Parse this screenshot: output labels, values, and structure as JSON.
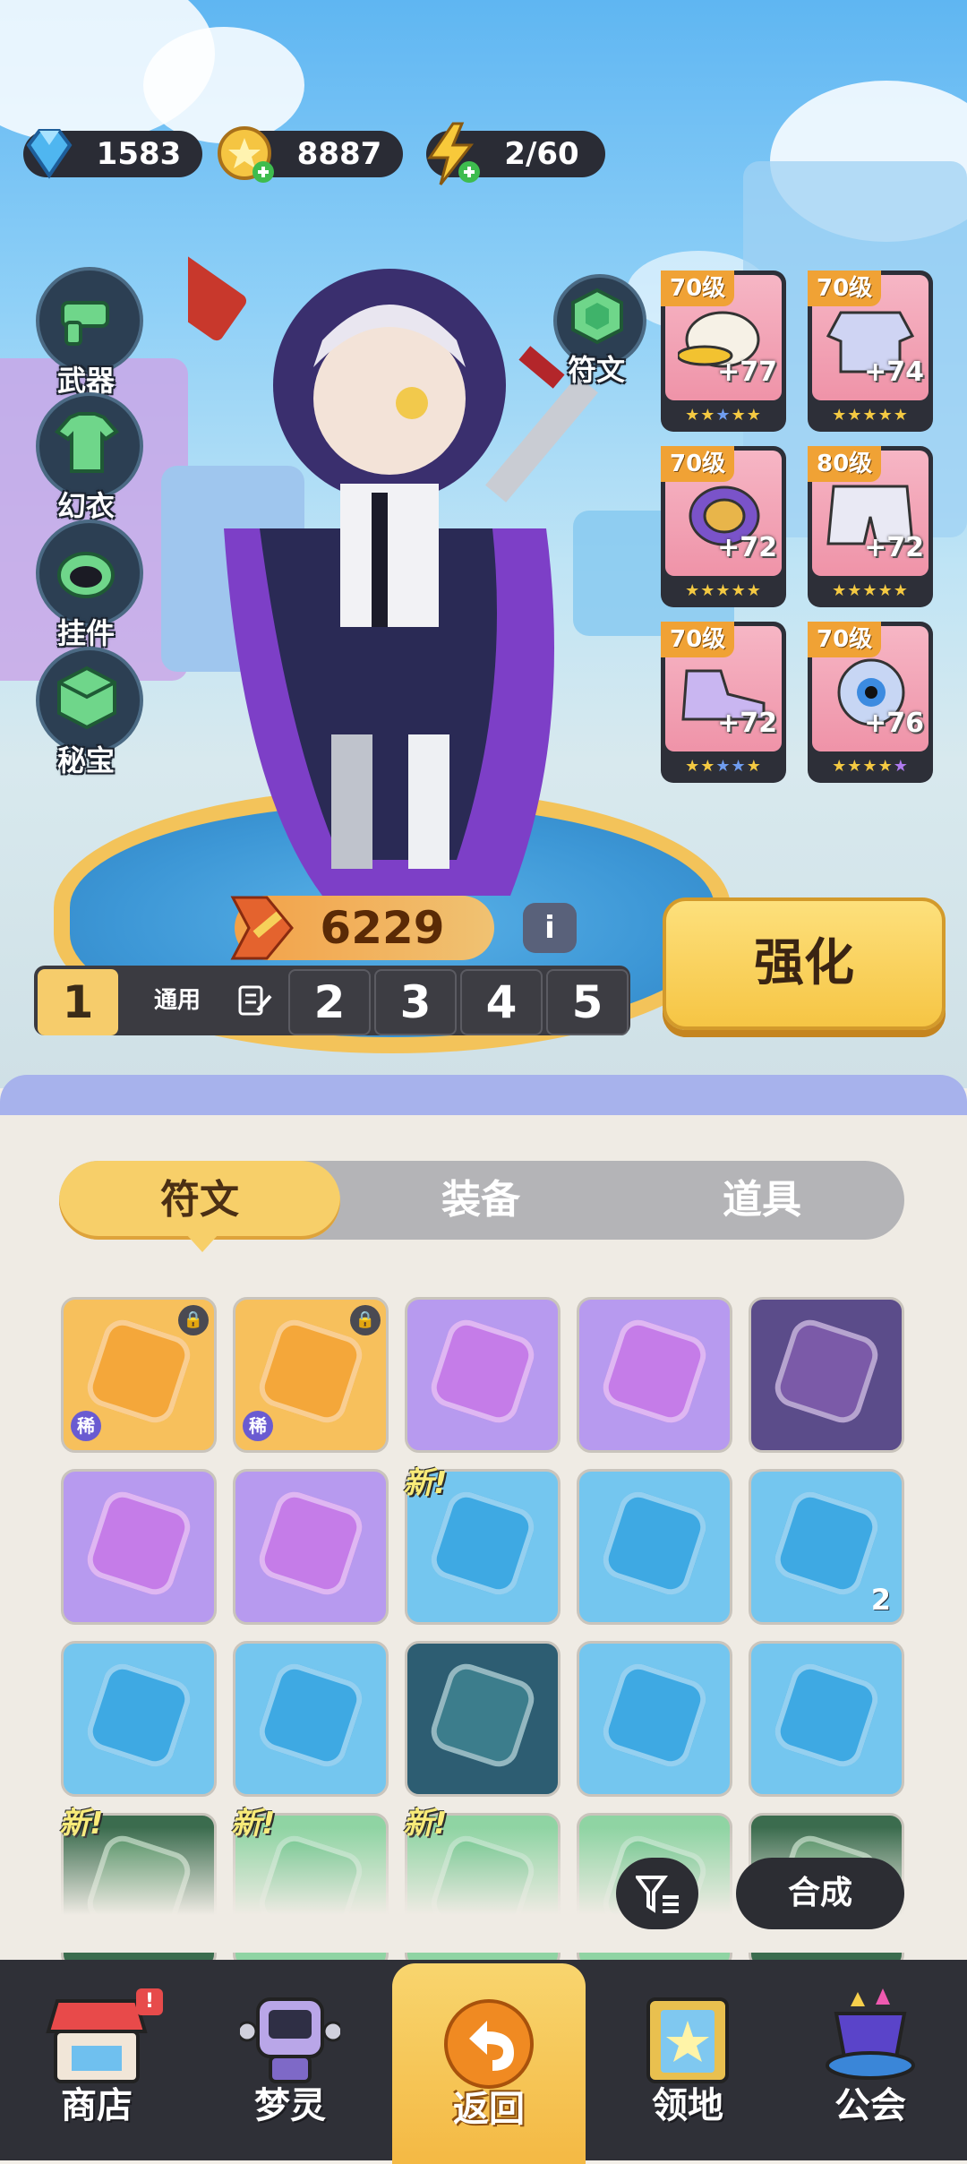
{
  "resources": {
    "gems": "1583",
    "coins": "8887",
    "energy": "2/60"
  },
  "left_menu": [
    "武器",
    "幻衣",
    "挂件",
    "秘宝"
  ],
  "rune_button": "符文",
  "equipment": [
    {
      "level": "70级",
      "plus": "+77",
      "icon": "duck-helmet-icon"
    },
    {
      "level": "70级",
      "plus": "+74",
      "icon": "puffer-jacket-icon"
    },
    {
      "level": "70级",
      "plus": "+72",
      "icon": "bracer-icon"
    },
    {
      "level": "80级",
      "plus": "+72",
      "icon": "shorts-icon"
    },
    {
      "level": "70级",
      "plus": "+72",
      "icon": "sneaker-icon"
    },
    {
      "level": "70级",
      "plus": "+76",
      "icon": "eyeball-accessory-icon"
    }
  ],
  "power": "6229",
  "info_glyph": "i",
  "presets": {
    "active": "1",
    "common_label": "通用",
    "others": [
      "2",
      "3",
      "4",
      "5"
    ]
  },
  "strengthen_button": "强化",
  "tabs": [
    "符文",
    "装备",
    "道具"
  ],
  "inventory": {
    "rare_badge": "稀",
    "new_tag": "新!",
    "stack_count": "2"
  },
  "actions": {
    "synthesize": "合成"
  },
  "bottom_nav": [
    "商店",
    "梦灵",
    "返回",
    "领地",
    "公会"
  ],
  "shop_badge": "!",
  "colors": {
    "accent": "#f7cf69",
    "panel": "#efebe4",
    "nav": "#2f3037",
    "gold_rune": "#f5b84a",
    "purple_rune": "#c08ae8",
    "blue_rune": "#5cc0ec"
  }
}
